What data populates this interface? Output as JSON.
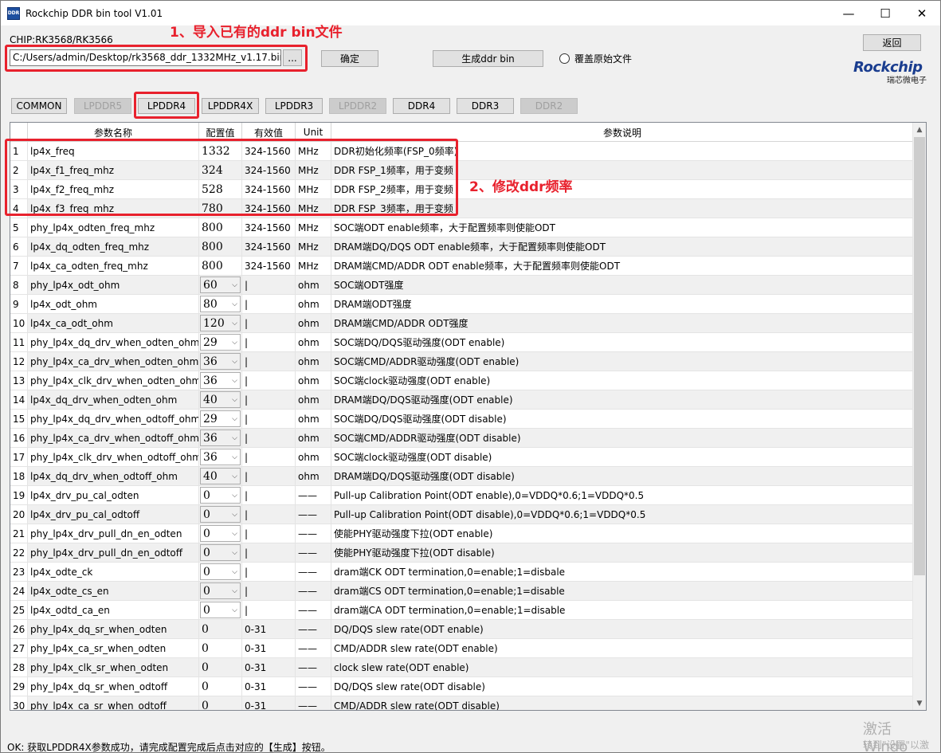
{
  "window": {
    "title": "Rockchip DDR bin tool V1.01",
    "icon_text": "DDR",
    "minimize_glyph": "—",
    "maximize_glyph": "☐",
    "close_glyph": "✕"
  },
  "chip_label": "CHIP:RK3568/RK3566",
  "file": {
    "path": "C:/Users/admin/Desktop/rk3568_ddr_1332MHz_v1.17.bin",
    "browse_label": "..."
  },
  "actions": {
    "confirm_label": "确定",
    "generate_label": "生成ddr bin",
    "back_label": "返回",
    "overwrite_label": "覆盖原始文件"
  },
  "logo": {
    "word": "Rockchip",
    "sub": "瑞芯微电子"
  },
  "annotations": {
    "step1": "1、导入已有的ddr bin文件",
    "step2": "2、修改ddr频率"
  },
  "tabs": [
    {
      "label": "COMMON",
      "enabled": true
    },
    {
      "label": "LPDDR5",
      "enabled": false
    },
    {
      "label": "LPDDR4",
      "enabled": true
    },
    {
      "label": "LPDDR4X",
      "enabled": true
    },
    {
      "label": "LPDDR3",
      "enabled": true
    },
    {
      "label": "LPDDR2",
      "enabled": false
    },
    {
      "label": "DDR4",
      "enabled": true
    },
    {
      "label": "DDR3",
      "enabled": true
    },
    {
      "label": "DDR2",
      "enabled": false
    }
  ],
  "grid": {
    "headers": {
      "name": "参数名称",
      "value": "配置值",
      "range": "有效值",
      "unit": "Unit",
      "desc": "参数说明"
    },
    "rows": [
      {
        "idx": "1",
        "name": "lp4x_freq",
        "value": "1332",
        "range": "324-1560",
        "unit": "MHz",
        "desc": "DDR初始化频率(FSP_0频率)",
        "combo": false
      },
      {
        "idx": "2",
        "name": "lp4x_f1_freq_mhz",
        "value": "324",
        "range": "324-1560",
        "unit": "MHz",
        "desc": "DDR FSP_1频率，用于变频",
        "combo": false
      },
      {
        "idx": "3",
        "name": "lp4x_f2_freq_mhz",
        "value": "528",
        "range": "324-1560",
        "unit": "MHz",
        "desc": "DDR FSP_2频率，用于变频",
        "combo": false
      },
      {
        "idx": "4",
        "name": "lp4x_f3_freq_mhz",
        "value": "780",
        "range": "324-1560",
        "unit": "MHz",
        "desc": "DDR FSP_3频率，用于变频",
        "combo": false
      },
      {
        "idx": "5",
        "name": "phy_lp4x_odten_freq_mhz",
        "value": "800",
        "range": "324-1560",
        "unit": "MHz",
        "desc": "SOC端ODT enable频率，大于配置频率则使能ODT",
        "combo": false
      },
      {
        "idx": "6",
        "name": "lp4x_dq_odten_freq_mhz",
        "value": "800",
        "range": "324-1560",
        "unit": "MHz",
        "desc": "DRAM端DQ/DQS ODT enable频率，大于配置频率则使能ODT",
        "combo": false
      },
      {
        "idx": "7",
        "name": "lp4x_ca_odten_freq_mhz",
        "value": "800",
        "range": "324-1560",
        "unit": "MHz",
        "desc": "DRAM端CMD/ADDR ODT enable频率，大于配置频率则使能ODT",
        "combo": false
      },
      {
        "idx": "8",
        "name": "phy_lp4x_odt_ohm",
        "value": "60",
        "range": "|",
        "unit": "ohm",
        "desc": "SOC端ODT强度",
        "combo": true
      },
      {
        "idx": "9",
        "name": "lp4x_odt_ohm",
        "value": "80",
        "range": "|",
        "unit": "ohm",
        "desc": "DRAM端ODT强度",
        "combo": true
      },
      {
        "idx": "10",
        "name": "lp4x_ca_odt_ohm",
        "value": "120",
        "range": "|",
        "unit": "ohm",
        "desc": "DRAM端CMD/ADDR ODT强度",
        "combo": true
      },
      {
        "idx": "11",
        "name": "phy_lp4x_dq_drv_when_odten_ohm",
        "value": "29",
        "range": "|",
        "unit": "ohm",
        "desc": "SOC端DQ/DQS驱动强度(ODT enable)",
        "combo": true
      },
      {
        "idx": "12",
        "name": "phy_lp4x_ca_drv_when_odten_ohm",
        "value": "36",
        "range": "|",
        "unit": "ohm",
        "desc": "SOC端CMD/ADDR驱动强度(ODT enable)",
        "combo": true
      },
      {
        "idx": "13",
        "name": "phy_lp4x_clk_drv_when_odten_ohm",
        "value": "36",
        "range": "|",
        "unit": "ohm",
        "desc": "SOC端clock驱动强度(ODT enable)",
        "combo": true
      },
      {
        "idx": "14",
        "name": "lp4x_dq_drv_when_odten_ohm",
        "value": "40",
        "range": "|",
        "unit": "ohm",
        "desc": "DRAM端DQ/DQS驱动强度(ODT enable)",
        "combo": true
      },
      {
        "idx": "15",
        "name": "phy_lp4x_dq_drv_when_odtoff_ohm",
        "value": "29",
        "range": "|",
        "unit": "ohm",
        "desc": "SOC端DQ/DQS驱动强度(ODT disable)",
        "combo": true
      },
      {
        "idx": "16",
        "name": "phy_lp4x_ca_drv_when_odtoff_ohm",
        "value": "36",
        "range": "|",
        "unit": "ohm",
        "desc": "SOC端CMD/ADDR驱动强度(ODT disable)",
        "combo": true
      },
      {
        "idx": "17",
        "name": "phy_lp4x_clk_drv_when_odtoff_ohm",
        "value": "36",
        "range": "|",
        "unit": "ohm",
        "desc": "SOC端clock驱动强度(ODT disable)",
        "combo": true
      },
      {
        "idx": "18",
        "name": "lp4x_dq_drv_when_odtoff_ohm",
        "value": "40",
        "range": "|",
        "unit": "ohm",
        "desc": "DRAM端DQ/DQS驱动强度(ODT disable)",
        "combo": true
      },
      {
        "idx": "19",
        "name": "lp4x_drv_pu_cal_odten",
        "value": "0",
        "range": "|",
        "unit": "——",
        "desc": "Pull-up Calibration Point(ODT enable),0=VDDQ*0.6;1=VDDQ*0.5",
        "combo": true
      },
      {
        "idx": "20",
        "name": "lp4x_drv_pu_cal_odtoff",
        "value": "0",
        "range": "|",
        "unit": "——",
        "desc": "Pull-up Calibration Point(ODT disable),0=VDDQ*0.6;1=VDDQ*0.5",
        "combo": true
      },
      {
        "idx": "21",
        "name": "phy_lp4x_drv_pull_dn_en_odten",
        "value": "0",
        "range": "|",
        "unit": "——",
        "desc": "使能PHY驱动强度下拉(ODT enable)",
        "combo": true
      },
      {
        "idx": "22",
        "name": "phy_lp4x_drv_pull_dn_en_odtoff",
        "value": "0",
        "range": "|",
        "unit": "——",
        "desc": "使能PHY驱动强度下拉(ODT disable)",
        "combo": true
      },
      {
        "idx": "23",
        "name": "lp4x_odte_ck",
        "value": "0",
        "range": "|",
        "unit": "——",
        "desc": "dram端CK ODT termination,0=enable;1=disbale",
        "combo": true
      },
      {
        "idx": "24",
        "name": "lp4x_odte_cs_en",
        "value": "0",
        "range": "|",
        "unit": "——",
        "desc": "dram端CS ODT termination,0=enable;1=disable",
        "combo": true
      },
      {
        "idx": "25",
        "name": "lp4x_odtd_ca_en",
        "value": "0",
        "range": "|",
        "unit": "——",
        "desc": "dram端CA ODT termination,0=enable;1=disable",
        "combo": true
      },
      {
        "idx": "26",
        "name": "phy_lp4x_dq_sr_when_odten",
        "value": "0",
        "range": "0-31",
        "unit": "——",
        "desc": "DQ/DQS slew rate(ODT enable)",
        "combo": false
      },
      {
        "idx": "27",
        "name": "phy_lp4x_ca_sr_when_odten",
        "value": "0",
        "range": "0-31",
        "unit": "——",
        "desc": "CMD/ADDR slew rate(ODT enable)",
        "combo": false
      },
      {
        "idx": "28",
        "name": "phy_lp4x_clk_sr_when_odten",
        "value": "0",
        "range": "0-31",
        "unit": "——",
        "desc": "clock slew rate(ODT enable)",
        "combo": false
      },
      {
        "idx": "29",
        "name": "phy_lp4x_dq_sr_when_odtoff",
        "value": "0",
        "range": "0-31",
        "unit": "——",
        "desc": "DQ/DQS slew rate(ODT disable)",
        "combo": false
      },
      {
        "idx": "30",
        "name": "phy_lp4x_ca_sr_when_odtoff",
        "value": "0",
        "range": "0-31",
        "unit": "——",
        "desc": "CMD/ADDR slew rate(ODT disable)",
        "combo": false
      }
    ]
  },
  "status": "OK: 获取LPDDR4X参数成功，请完成配置完成后点击对应的【生成】按钮。",
  "watermark": {
    "line1": "激活 Windo",
    "line2": "转到\"设置\"以激"
  }
}
